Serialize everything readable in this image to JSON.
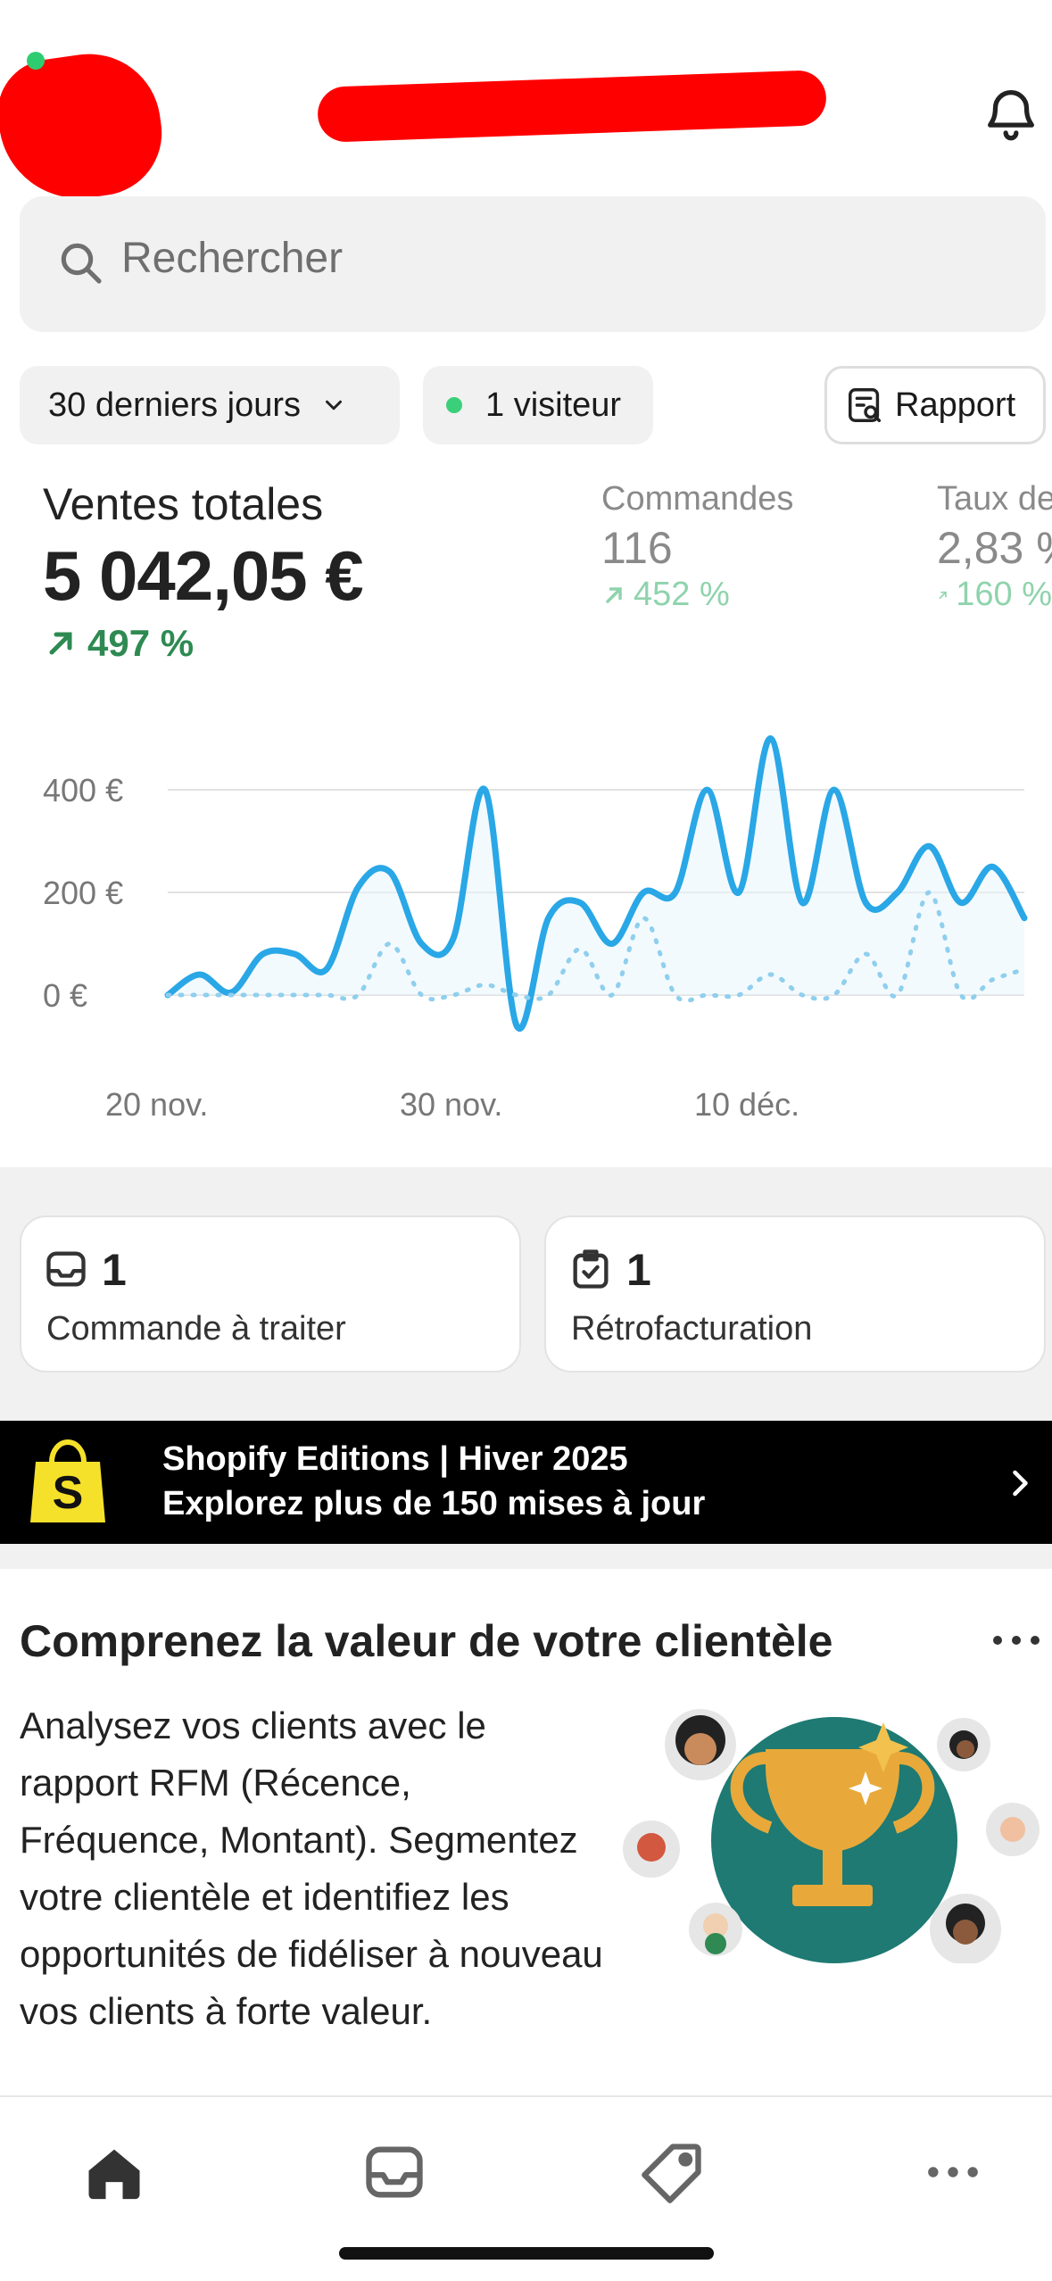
{
  "header": {
    "store_name_redacted": true,
    "notification_icon": "bell-icon"
  },
  "search": {
    "placeholder": "Rechercher",
    "icon": "search-icon"
  },
  "filters": {
    "period_label": "30 derniers jours",
    "visitors_label": "1 visiteur",
    "visitor_dot_color": "#3ccf7a",
    "report_label": "Rapport"
  },
  "metrics": {
    "total_sales": {
      "label": "Ventes totales",
      "value": "5 042,05 €",
      "delta": "497 %"
    },
    "orders": {
      "label": "Commandes",
      "value": "116",
      "delta": "452 %"
    },
    "conversion": {
      "label": "Taux de",
      "value": "2,83 %",
      "delta": "160 %"
    }
  },
  "chart_data": {
    "type": "line",
    "y_ticks": [
      "400 €",
      "200 €",
      "0 €"
    ],
    "x_ticks": [
      "20 nov.",
      "30 nov.",
      "10 déc."
    ],
    "ylim": [
      0,
      400
    ],
    "series": [
      {
        "style": "solid",
        "color": "#29a7e6",
        "values": [
          0,
          40,
          5,
          80,
          80,
          50,
          210,
          240,
          100,
          110,
          400,
          -60,
          150,
          180,
          100,
          200,
          200,
          400,
          200,
          500,
          180,
          400,
          180,
          200,
          290,
          180,
          250,
          150
        ]
      },
      {
        "style": "dotted",
        "color": "#8fcfee",
        "values": [
          0,
          0,
          0,
          0,
          0,
          0,
          0,
          100,
          0,
          0,
          20,
          0,
          0,
          90,
          0,
          150,
          0,
          0,
          0,
          40,
          0,
          0,
          80,
          0,
          200,
          0,
          30,
          50
        ]
      }
    ]
  },
  "tasks": [
    {
      "icon": "inbox-icon",
      "count": "1",
      "label": "Commande à traiter"
    },
    {
      "icon": "clipboard-check-icon",
      "count": "1",
      "label": "Rétrofacturation"
    }
  ],
  "banner": {
    "logo": "shopify-bag-icon",
    "title": "Shopify Editions | Hiver 2025",
    "subtitle": "Explorez plus de 150 mises à jour"
  },
  "insight": {
    "title": "Comprenez la valeur de votre clientèle",
    "body": "Analysez vos clients avec le rapport RFM (Récence, Fréquence, Montant). Segmentez votre clientèle et identifiez les opportunités de fidéliser à nouveau vos clients à forte valeur.",
    "illustration": "trophy-customers-illustration"
  },
  "bottom_nav": [
    "home-icon",
    "orders-icon",
    "products-tag-icon",
    "more-icon"
  ]
}
